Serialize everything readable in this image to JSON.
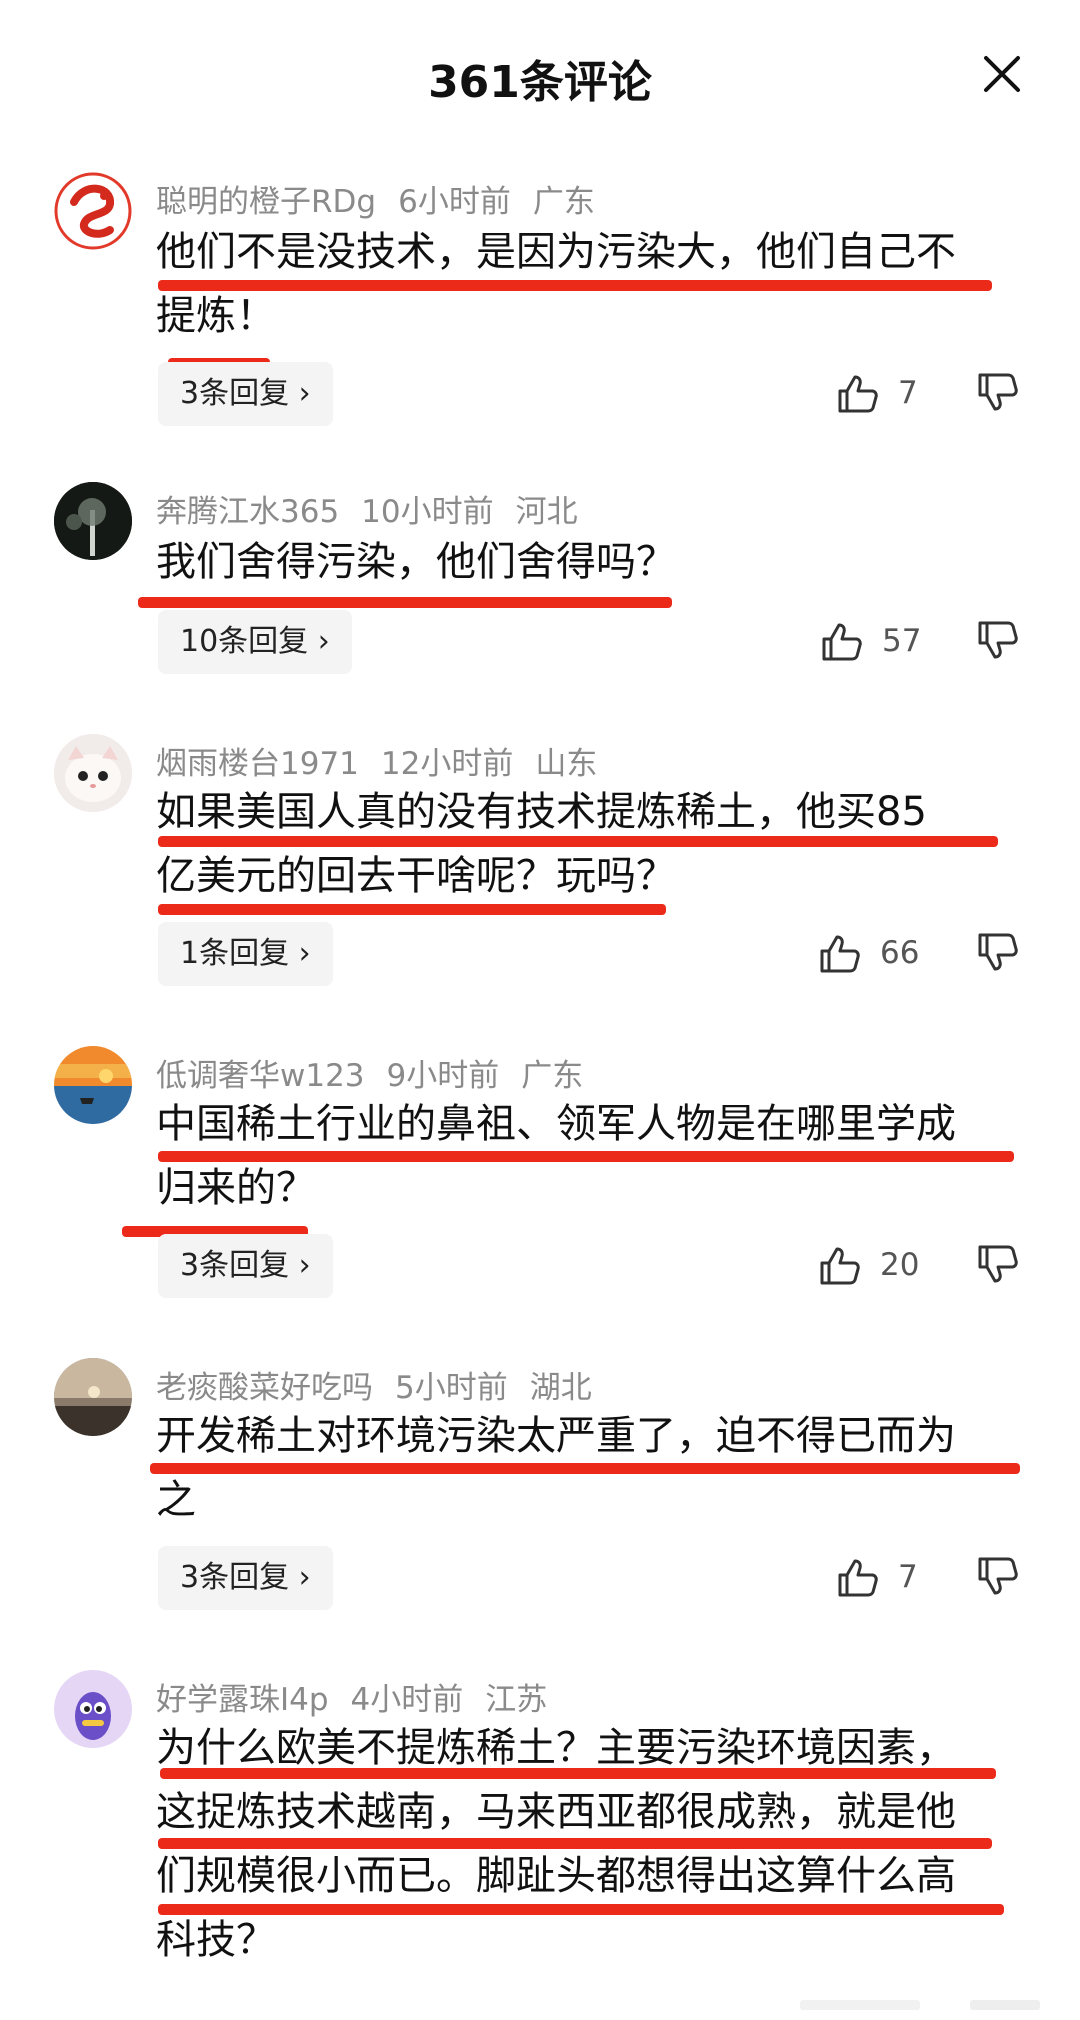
{
  "header": {
    "title": "361条评论"
  },
  "comments": [
    {
      "user": "聪明的橙子RDg",
      "time": "6小时前",
      "region": "广东",
      "lines": [
        "他们不是没技术，是因为污染大，他们自己不",
        "提炼！"
      ],
      "replies": "3条回复 ›",
      "likes": "7"
    },
    {
      "user": "奔腾江水365",
      "time": "10小时前",
      "region": "河北",
      "lines": [
        "我们舍得污染，他们舍得吗？"
      ],
      "replies": "10条回复 ›",
      "likes": "57"
    },
    {
      "user": "烟雨楼台1971",
      "time": "12小时前",
      "region": "山东",
      "lines": [
        "如果美国人真的没有技术提炼稀土，他买85",
        "亿美元的回去干啥呢？玩吗？"
      ],
      "replies": "1条回复 ›",
      "likes": "66"
    },
    {
      "user": "低调奢华w123",
      "time": "9小时前",
      "region": "广东",
      "lines": [
        "中国稀土行业的鼻祖、领军人物是在哪里学成",
        "归来的？"
      ],
      "replies": "3条回复 ›",
      "likes": "20"
    },
    {
      "user": "老痰酸菜好吃吗",
      "time": "5小时前",
      "region": "湖北",
      "lines": [
        "开发稀土对环境污染太严重了，迫不得已而为",
        "之"
      ],
      "replies": "3条回复 ›",
      "likes": "7"
    },
    {
      "user": "好学露珠I4p",
      "time": "4小时前",
      "region": "江苏",
      "lines": [
        "为什么欧美不提炼稀土？主要污染环境因素，",
        "这捉炼技术越南，马来西亚都很成熟，就是他",
        "们规模很小而已。脚趾头都想得出这算什么高",
        "科技？"
      ]
    }
  ],
  "colors": {
    "underline": "#ec2a1a",
    "meta": "#8a8a8a"
  },
  "icons": {
    "close": "close-icon",
    "like": "thumbs-up-icon",
    "dislike": "thumbs-down-icon"
  }
}
